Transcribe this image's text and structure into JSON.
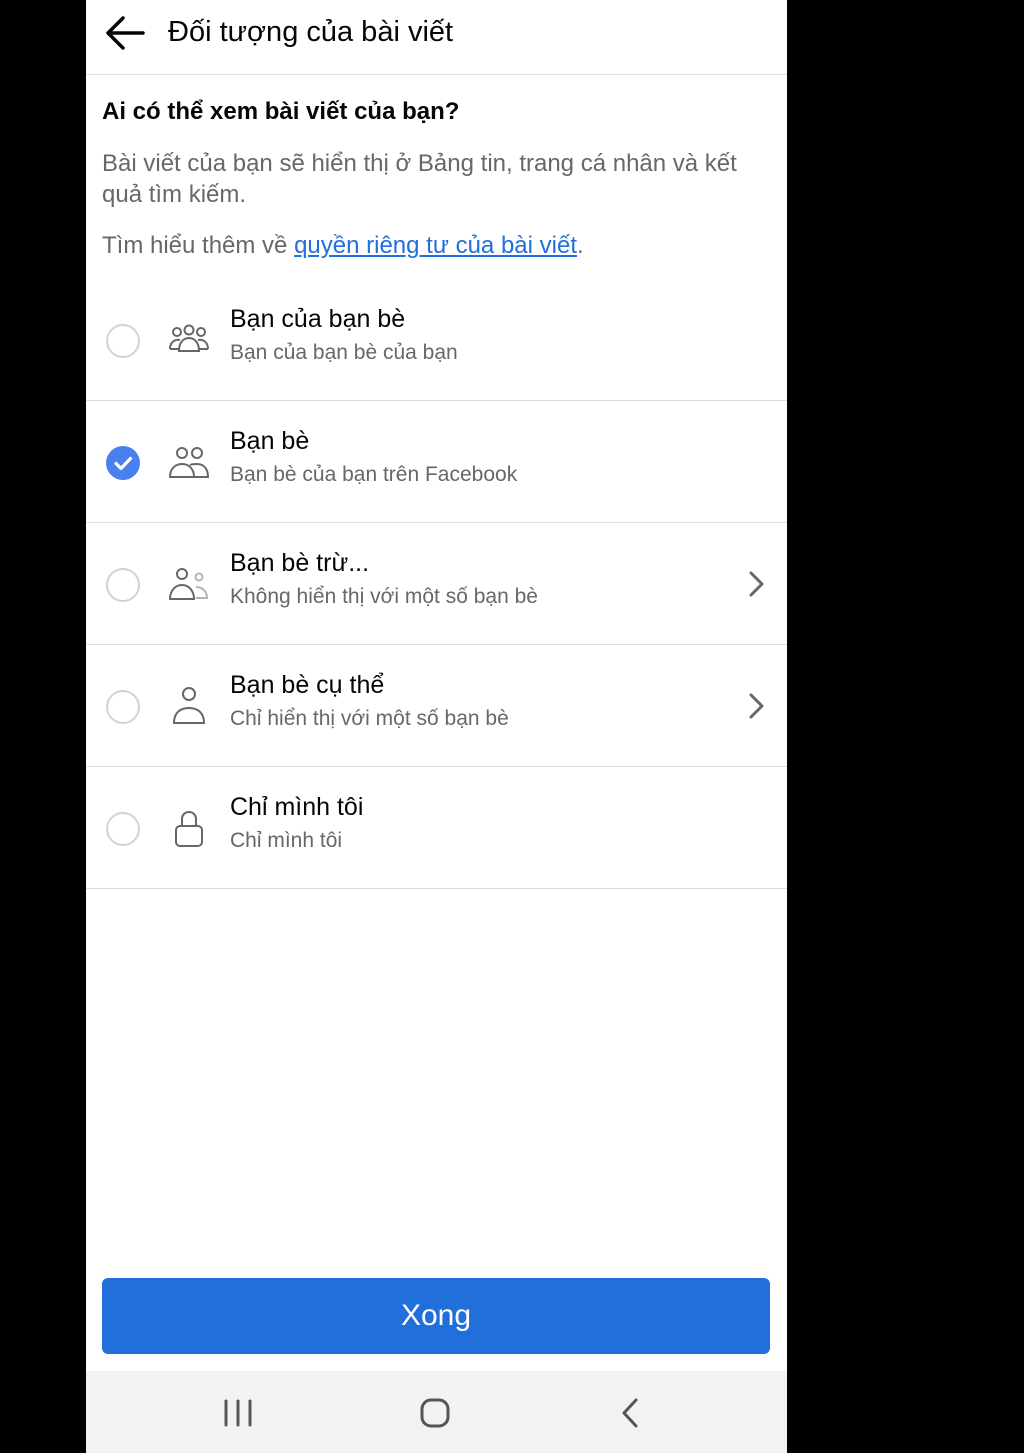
{
  "header": {
    "title": "Đối tượng của bài viết"
  },
  "intro": {
    "question": "Ai có thể xem bài viết của bạn?",
    "description": "Bài viết của bạn sẽ hiển thị ở Bảng tin, trang cá nhân và kết quả tìm kiếm.",
    "learn_more_prefix": "Tìm hiểu thêm về ",
    "learn_more_link": "quyền riêng tư của bài viết",
    "learn_more_suffix": "."
  },
  "options": [
    {
      "title": "Bạn của bạn bè",
      "subtitle": "Bạn của bạn bè của bạn",
      "icon": "friends-of-friends-icon",
      "selected": false,
      "has_chevron": false
    },
    {
      "title": "Bạn bè",
      "subtitle": "Bạn bè của bạn trên Facebook",
      "icon": "friends-icon",
      "selected": true,
      "has_chevron": false
    },
    {
      "title": "Bạn bè trừ...",
      "subtitle": "Không hiển thị với một số bạn bè",
      "icon": "friends-except-icon",
      "selected": false,
      "has_chevron": true
    },
    {
      "title": "Bạn bè cụ thể",
      "subtitle": "Chỉ hiển thị với một số bạn bè",
      "icon": "person-icon",
      "selected": false,
      "has_chevron": true
    },
    {
      "title": "Chỉ mình tôi",
      "subtitle": "Chỉ mình tôi",
      "icon": "lock-icon",
      "selected": false,
      "has_chevron": false
    }
  ],
  "done_button": {
    "label": "Xong"
  },
  "colors": {
    "accent": "#216fdb",
    "radio_checked": "#4a7ff0",
    "secondary_text": "#65676b"
  },
  "navbar": {
    "icons": [
      "recent-apps-icon",
      "home-icon",
      "back-icon"
    ]
  }
}
